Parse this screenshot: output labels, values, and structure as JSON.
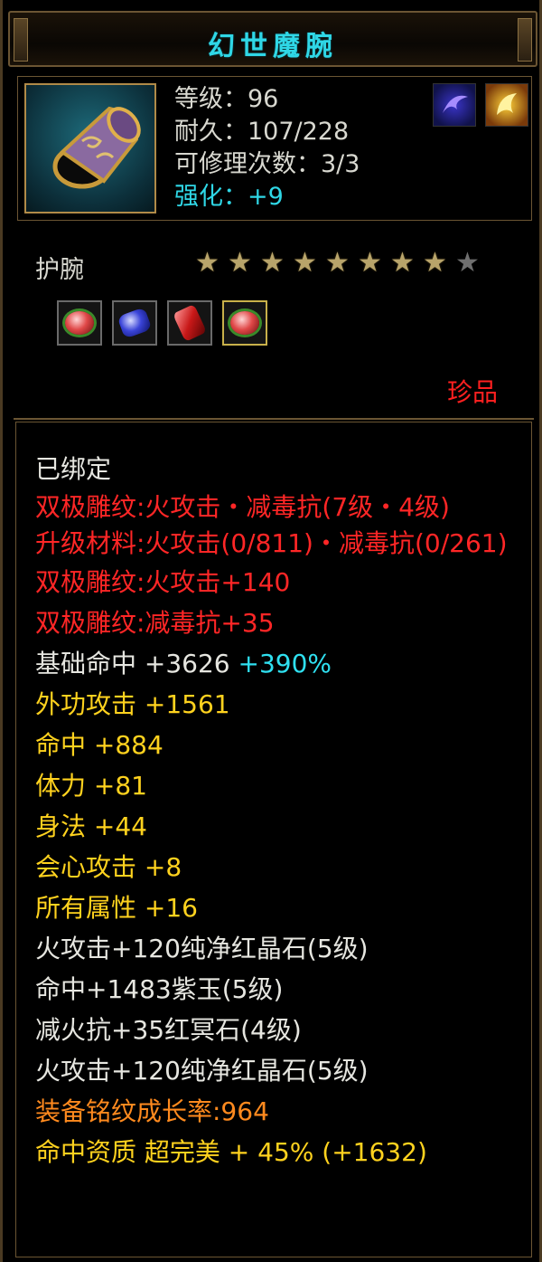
{
  "title": "幻世魔腕",
  "item": {
    "icon": "bracer-icon",
    "level_label": "等级：96",
    "durability_label": "耐久：107/228",
    "repair_label": "可修理次数：3/3",
    "enhance_label": "强化：+9",
    "badges": [
      "purple-swirl-icon",
      "fire-swirl-icon"
    ]
  },
  "type_label": "护腕",
  "stars": {
    "total": 9,
    "filled": 8
  },
  "gems": [
    "red-gem-icon",
    "blue-gem-icon",
    "ruby-gem-icon",
    "red-gem-icon"
  ],
  "rarity": "珍品",
  "colors": {
    "title": "#2fd7e6",
    "white": "#e6e6e0",
    "red": "#ff2626",
    "yellow": "#ffd21e",
    "cyan": "#2fe0f0",
    "orange": "#ff8a1e",
    "border": "#6b5533"
  },
  "details": {
    "bound": "已绑定",
    "engrave_1": "双极雕纹:火攻击・减毒抗(7级・4级)",
    "upgrade_mat": "升级材料:火攻击(0/811)・减毒抗(0/261)",
    "engrave_2": "双极雕纹:火攻击+140",
    "engrave_3": "双极雕纹:减毒抗+35",
    "base_hit": "基础命中 +3626",
    "base_hit_pct": "+390%",
    "ext_attack": "外功攻击 +1561",
    "hit": "命中 +884",
    "stamina": "体力 +81",
    "agility": "身法 +44",
    "crit": "会心攻击 +8",
    "all_attr": "所有属性 +16",
    "gem_1": "火攻击+120纯净红晶石(5级)",
    "gem_2": "命中+1483紫玉(5级)",
    "gem_3": "减火抗+35红冥石(4级)",
    "gem_4": "火攻击+120纯净红晶石(5级)",
    "growth": "装备铭纹成长率:964",
    "hit_quality": "命中资质 超完美 + 45% (+1632)"
  }
}
